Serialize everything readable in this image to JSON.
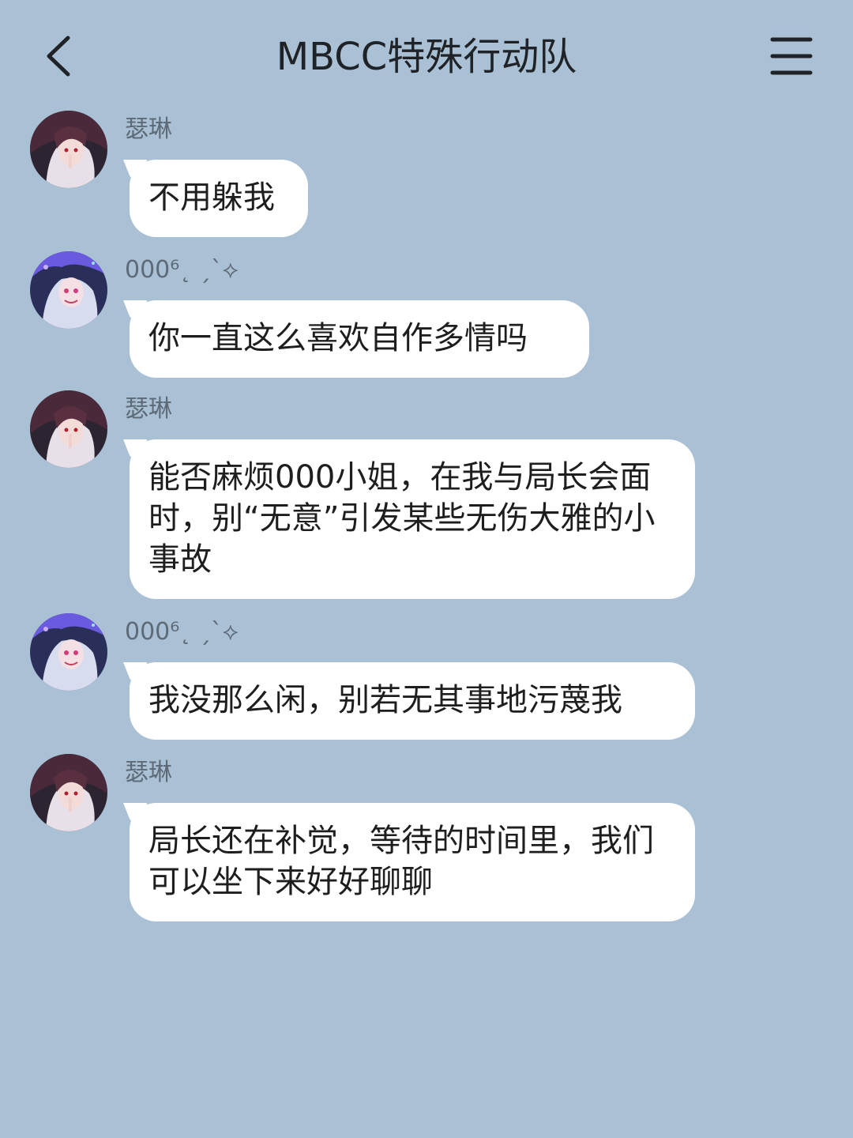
{
  "header": {
    "title": "MBCC特殊行动队",
    "back_icon": "chevron-left-icon",
    "menu_icon": "hamburger-menu-icon"
  },
  "messages": [
    {
      "sender": "瑟琳",
      "avatar": "avatar-serene",
      "text": "不用躲我"
    },
    {
      "sender": "000⁶˛ ˏˋ⟡",
      "avatar": "avatar-000",
      "text": "你一直这么喜欢自作多情吗"
    },
    {
      "sender": "瑟琳",
      "avatar": "avatar-serene",
      "text": "能否麻烦000小姐，在我与局长会面时，别“无意”引发某些无伤大雅的小事故"
    },
    {
      "sender": "000⁶˛ ˏˋ⟡",
      "avatar": "avatar-000",
      "text": "我没那么闲，别若无其事地污蔑我"
    },
    {
      "sender": "瑟琳",
      "avatar": "avatar-serene",
      "text": "局长还在补觉，等待的时间里，我们可以坐下来好好聊聊"
    }
  ],
  "colors": {
    "background": "#aac0d4",
    "bubble": "#ffffff",
    "sender_name": "#5d6a78",
    "text": "#1e1e1e"
  }
}
